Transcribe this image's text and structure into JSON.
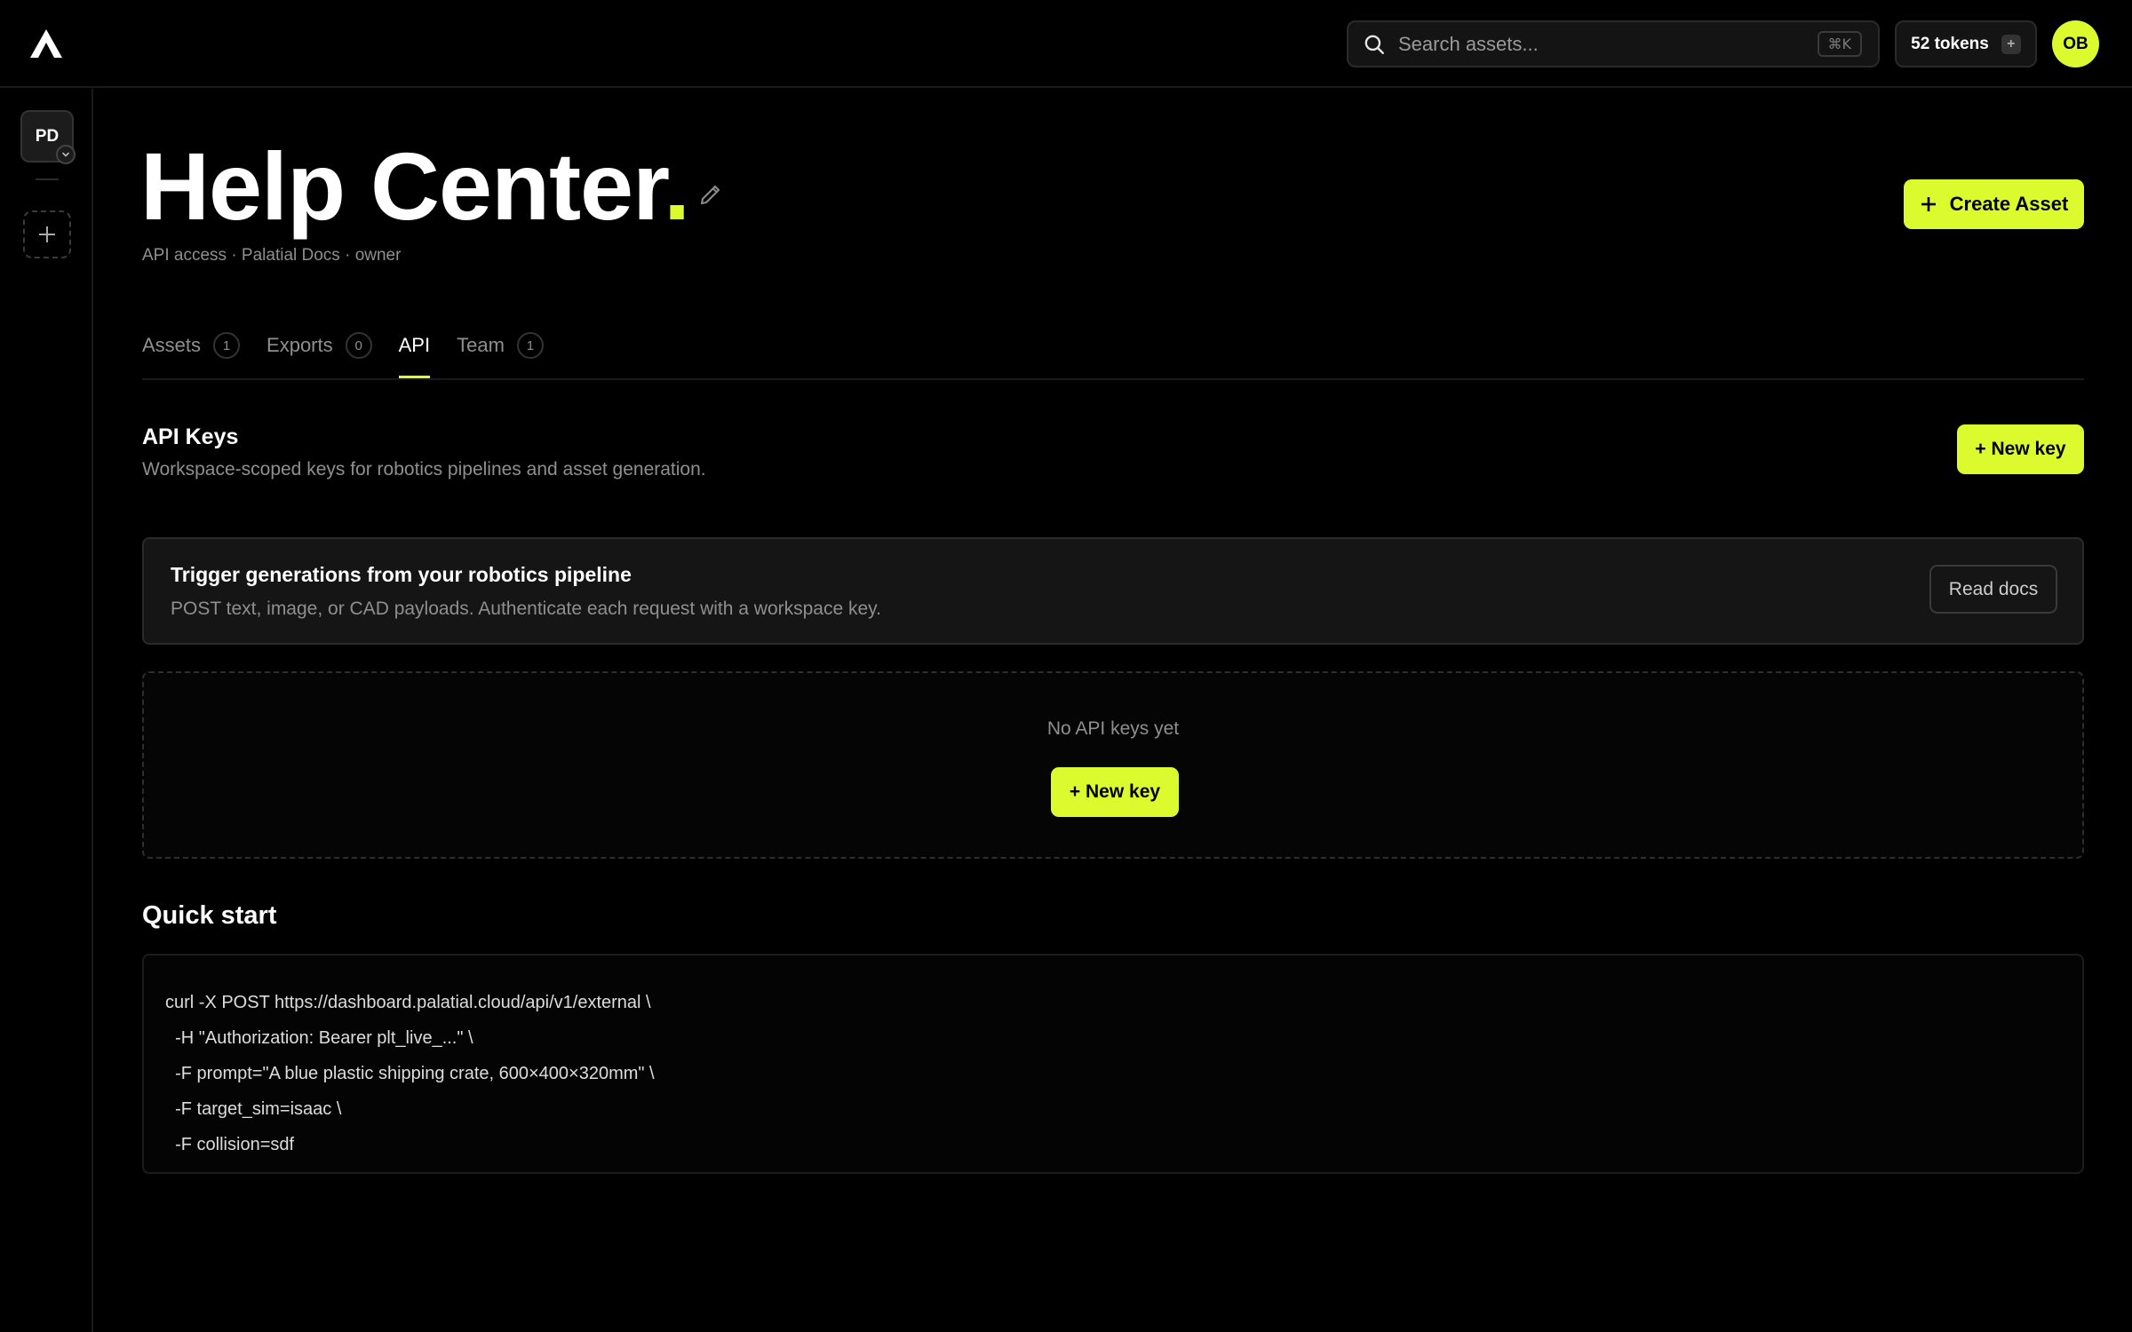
{
  "topbar": {
    "search_placeholder": "Search assets...",
    "search_shortcut": "⌘K",
    "tokens_label": "52 tokens",
    "tokens_add": "+",
    "user_initials": "OB"
  },
  "sidebar": {
    "workspace_initials": "PD"
  },
  "header": {
    "title": "Help Center",
    "title_dot": ".",
    "subtitle": "API access · Palatial Docs · owner",
    "create_button": "Create Asset"
  },
  "tabs": [
    {
      "label": "Assets",
      "count": "1"
    },
    {
      "label": "Exports",
      "count": "0"
    },
    {
      "label": "API",
      "count": null,
      "active": true
    },
    {
      "label": "Team",
      "count": "1"
    }
  ],
  "api_keys": {
    "title": "API Keys",
    "description": "Workspace-scoped keys for robotics pipelines and asset generation.",
    "new_key_label": "+ New key"
  },
  "info_card": {
    "title": "Trigger generations from your robotics pipeline",
    "description": "POST text, image, or CAD payloads. Authenticate each request with a workspace key.",
    "button": "Read docs"
  },
  "empty_state": {
    "text": "No API keys yet",
    "button": "+ New key"
  },
  "quick_start": {
    "title": "Quick start",
    "code_lines": [
      "curl -X POST https://dashboard.palatial.cloud/api/v1/external \\",
      "  -H \"Authorization: Bearer plt_live_...\" \\",
      "  -F prompt=\"A blue plastic shipping crate, 600×400×320mm\" \\",
      "  -F target_sim=isaac \\",
      "  -F collision=sdf"
    ]
  },
  "colors": {
    "accent": "#dcfb2e",
    "background": "#000000",
    "muted_text": "#8f8f8f",
    "card": "#151515"
  },
  "icons": [
    "logo-icon",
    "search-icon",
    "edit-icon",
    "plus-icon",
    "chevron-down-icon"
  ]
}
